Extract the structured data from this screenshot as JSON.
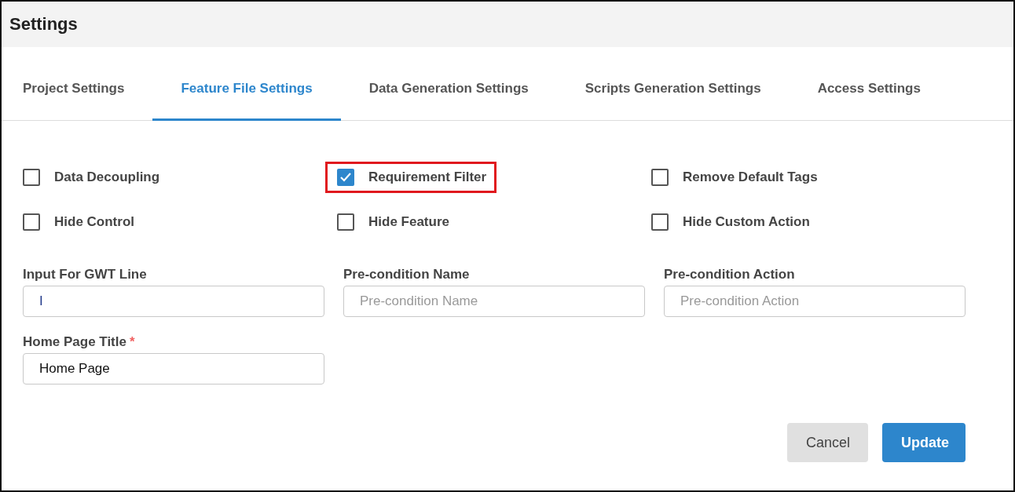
{
  "window": {
    "title": "Settings"
  },
  "tabs": [
    {
      "label": "Project Settings",
      "selected": false
    },
    {
      "label": "Feature File Settings",
      "selected": true
    },
    {
      "label": "Data Generation Settings",
      "selected": false
    },
    {
      "label": "Scripts Generation Settings",
      "selected": false
    },
    {
      "label": "Access Settings",
      "selected": false
    }
  ],
  "options": [
    {
      "label": "Data Decoupling",
      "checked": false,
      "highlighted": false
    },
    {
      "label": "Requirement Filter",
      "checked": true,
      "highlighted": true
    },
    {
      "label": "Remove Default Tags",
      "checked": false,
      "highlighted": false
    },
    {
      "label": "Hide Control",
      "checked": false,
      "highlighted": false
    },
    {
      "label": "Hide Feature",
      "checked": false,
      "highlighted": false
    },
    {
      "label": "Hide Custom Action",
      "checked": false,
      "highlighted": false
    }
  ],
  "fields": [
    {
      "label": "Input For GWT Line",
      "value": "I"
    },
    {
      "label": "Pre-condition Name",
      "placeholder": "Pre-condition Name"
    },
    {
      "label": "Pre-condition Action",
      "placeholder": "Pre-condition Action"
    },
    {
      "label": "Home Page Title",
      "required_mark": "*",
      "value": "Home Page"
    }
  ],
  "buttons": [
    {
      "label": "Cancel",
      "kind": "secondary"
    },
    {
      "label": "Update",
      "kind": "primary"
    }
  ]
}
